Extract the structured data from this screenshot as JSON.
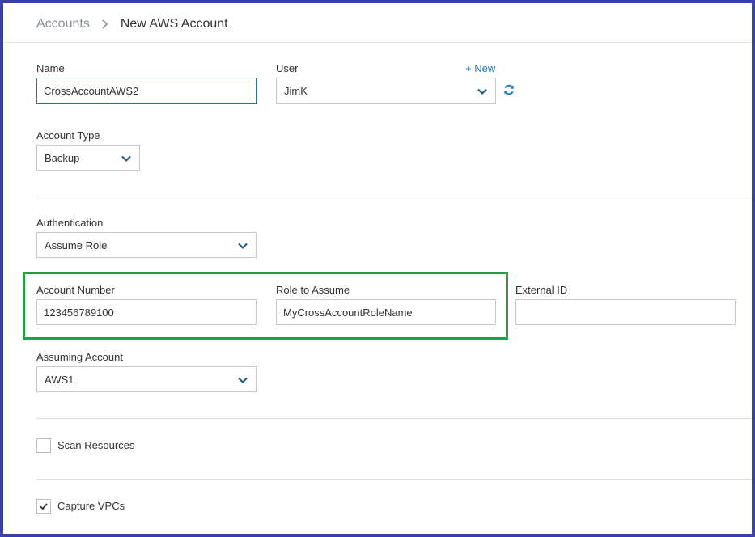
{
  "breadcrumb": {
    "parent": "Accounts",
    "current": "New AWS Account"
  },
  "form": {
    "name": {
      "label": "Name",
      "value": "CrossAccountAWS2"
    },
    "user": {
      "label": "User",
      "value": "JimK",
      "new_link": "+ New"
    },
    "account_type": {
      "label": "Account Type",
      "value": "Backup"
    },
    "authentication": {
      "label": "Authentication",
      "value": "Assume Role"
    },
    "account_number": {
      "label": "Account Number",
      "value": "123456789100"
    },
    "role_to_assume": {
      "label": "Role to Assume",
      "value": "MyCrossAccountRoleName"
    },
    "external_id": {
      "label": "External ID",
      "value": ""
    },
    "assuming_account": {
      "label": "Assuming Account",
      "value": "AWS1"
    },
    "scan_resources": {
      "label": "Scan Resources",
      "checked": false
    },
    "capture_vpcs": {
      "label": "Capture VPCs",
      "checked": true
    }
  },
  "colors": {
    "accent": "#1f7bbd",
    "chevron": "#1d5f8a",
    "highlight": "#21a24a",
    "frame": "#3b3fae"
  },
  "icons": {
    "breadcrumb_separator": "chevron-right-icon",
    "dropdown": "chevron-down-icon",
    "refresh": "refresh-icon",
    "check": "checkmark-icon"
  }
}
